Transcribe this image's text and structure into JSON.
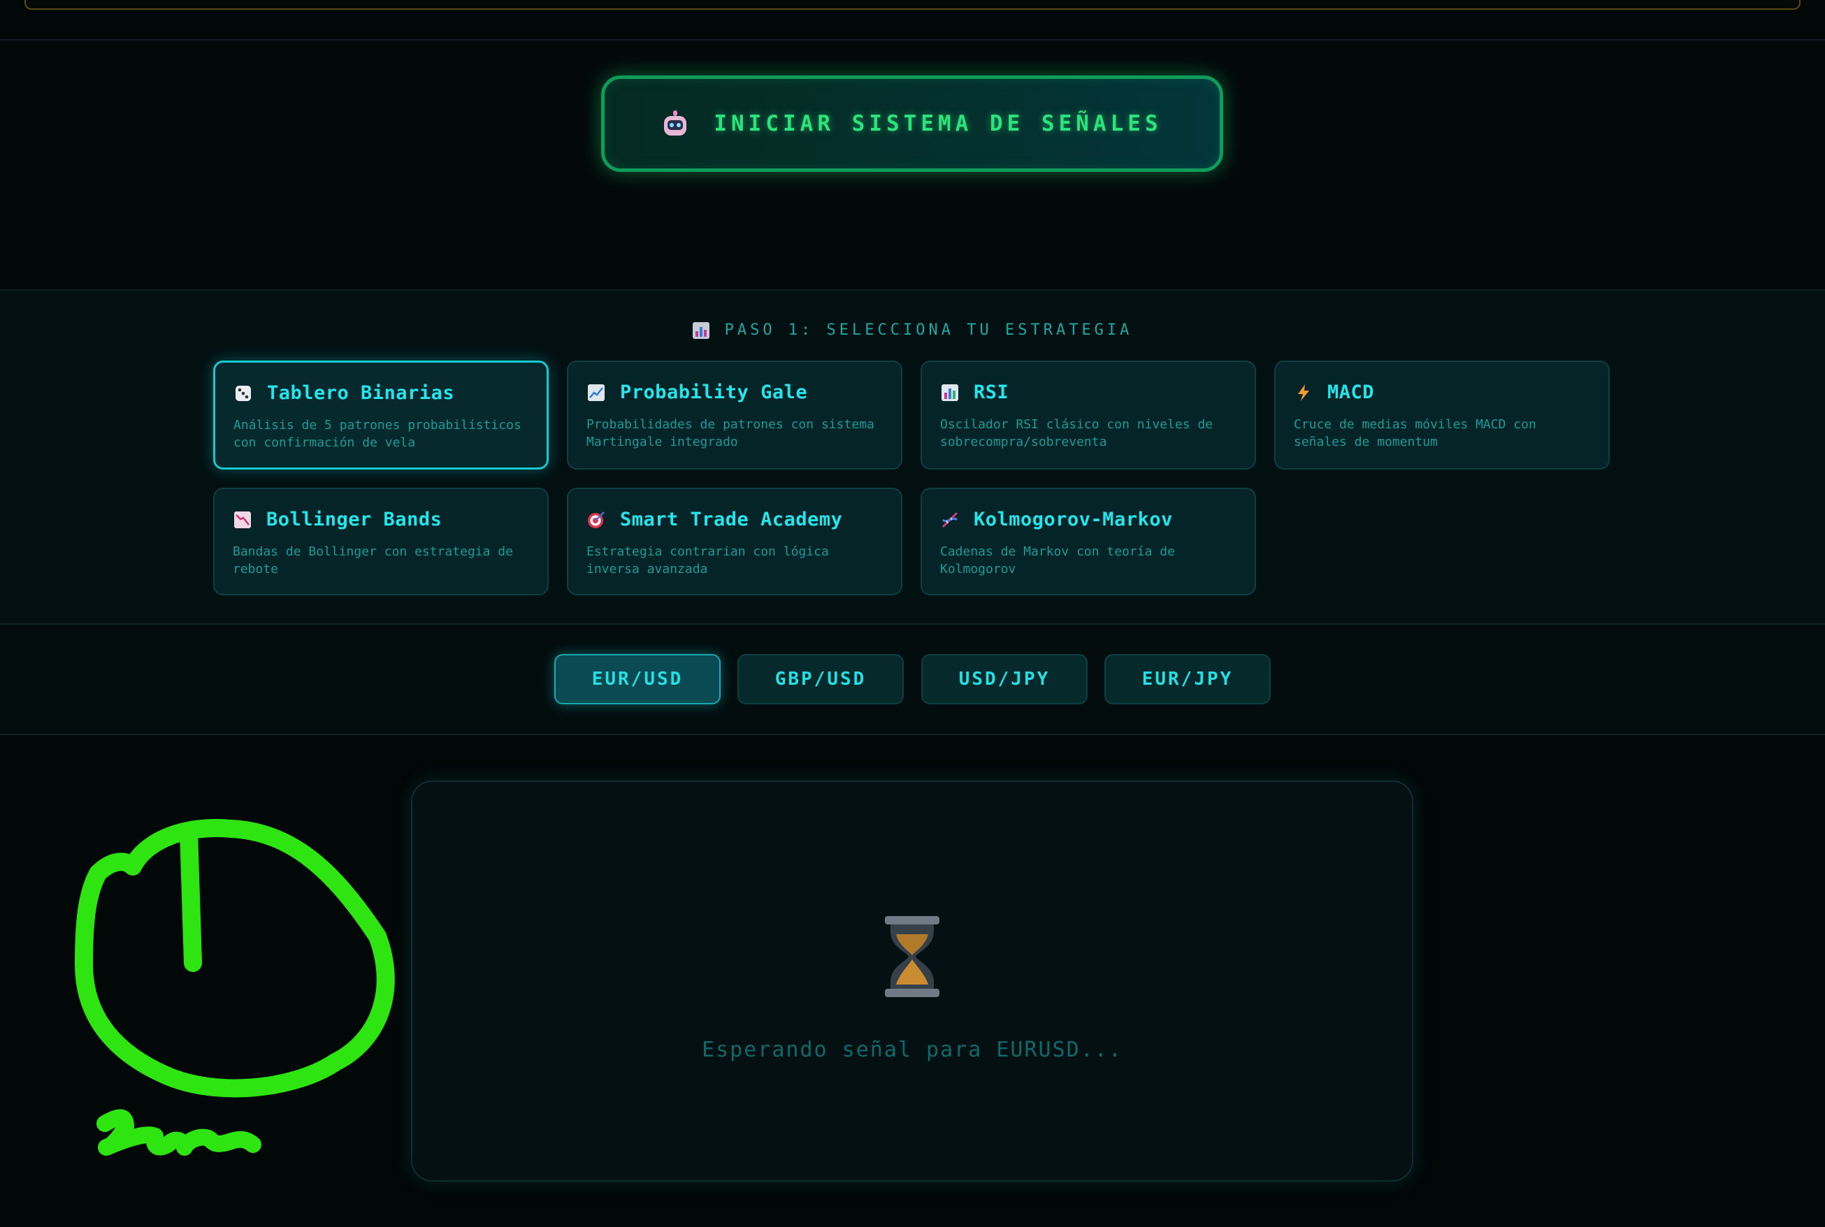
{
  "start": {
    "label": "INICIAR SISTEMA DE SEÑALES",
    "icon": "robot-icon"
  },
  "strategy": {
    "step_title": "PASO 1: SELECCIONA TU ESTRATEGIA",
    "cards": [
      {
        "title": "Tablero Binarias",
        "desc": "Análisis de 5 patrones probabilísticos con confirmación de vela",
        "icon": "dice-icon",
        "active": true
      },
      {
        "title": "Probability Gale",
        "desc": "Probabilidades de patrones con sistema Martingale integrado",
        "icon": "chart-up-icon",
        "active": false
      },
      {
        "title": "RSI",
        "desc": "Oscilador RSI clásico con niveles de sobrecompra/sobreventa",
        "icon": "bar-chart-icon",
        "active": false
      },
      {
        "title": "MACD",
        "desc": "Cruce de medias móviles MACD con señales de momentum",
        "icon": "lightning-icon",
        "active": false
      },
      {
        "title": "Bollinger Bands",
        "desc": "Bandas de Bollinger con estrategia de rebote",
        "icon": "chart-down-icon",
        "active": false
      },
      {
        "title": "Smart Trade Academy",
        "desc": "Estrategia contrarian con lógica inversa avanzada",
        "icon": "target-icon",
        "active": false
      },
      {
        "title": "Kolmogorov-Markov",
        "desc": "Cadenas de Markov con teoría de Kolmogorov",
        "icon": "dna-icon",
        "active": false
      }
    ]
  },
  "pairs": [
    {
      "label": "EUR/USD",
      "active": true
    },
    {
      "label": "GBP/USD",
      "active": false
    },
    {
      "label": "USD/JPY",
      "active": false
    },
    {
      "label": "EUR/JPY",
      "active": false
    }
  ],
  "signal": {
    "waiting_text": "Esperando señal para EURUSD...",
    "icon": "hourglass-icon"
  },
  "colors": {
    "accent": "#25e4ea",
    "start_green": "#2be37a",
    "annotation_green": "#2ee512"
  }
}
